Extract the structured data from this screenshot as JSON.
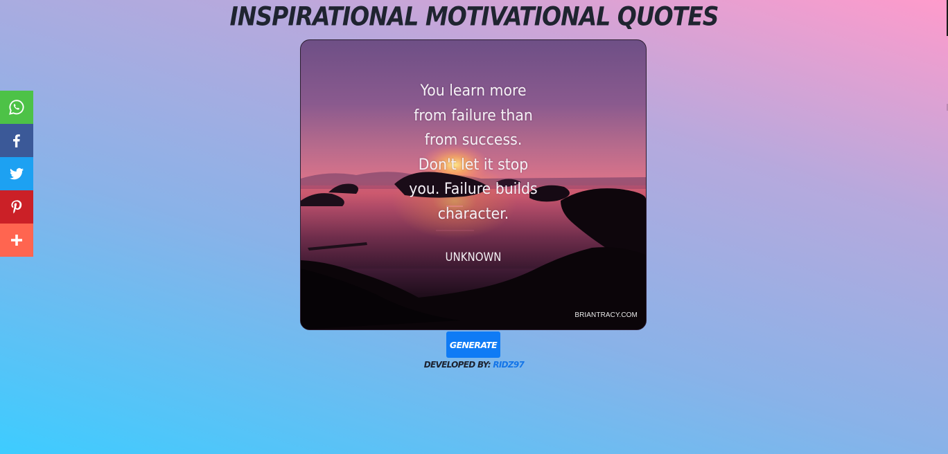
{
  "header": {
    "title": "Inspirational Motivational Quotes"
  },
  "quote": {
    "lines": [
      "You learn more",
      "from failure than",
      "from success.",
      "Don't let it stop",
      "you. Failure builds",
      "character."
    ],
    "author": "UNKNOWN",
    "source": "BRIANTRACY.COM"
  },
  "actions": {
    "generate_label": "Generate"
  },
  "footer": {
    "developed_by_label": "Developed By:",
    "developer_name": "Ridz97"
  },
  "share_bar": {
    "items": [
      {
        "name": "whatsapp",
        "icon": "whatsapp-icon",
        "color": "#4dc247"
      },
      {
        "name": "facebook",
        "icon": "facebook-icon",
        "color": "#3b5998"
      },
      {
        "name": "twitter",
        "icon": "twitter-icon",
        "color": "#1da1f2"
      },
      {
        "name": "pinterest",
        "icon": "pinterest-icon",
        "color": "#cb2027"
      },
      {
        "name": "more",
        "icon": "plus-icon",
        "color": "#ff6550"
      }
    ]
  },
  "colors": {
    "button_blue": "#0f7bf5",
    "link_blue": "#1475e8",
    "title_dark": "#1f2430"
  }
}
